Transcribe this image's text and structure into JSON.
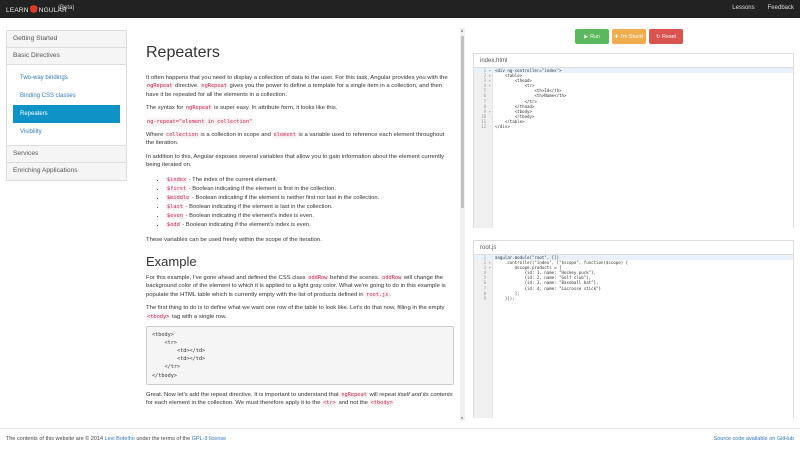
{
  "navbar": {
    "brand_left": "LEARN",
    "brand_right": "NGULAR",
    "beta": "(Beta)",
    "links": [
      "Lessons",
      "Feedback"
    ]
  },
  "sidebar": {
    "getting_started": "Getting Started",
    "basic_directives": "Basic Directives",
    "sub_items": [
      "Two-way bindings",
      "Binding CSS classes",
      "Repeaters",
      "Visibility"
    ],
    "active_item": "Repeaters",
    "services": "Services",
    "enriching": "Enriching Applications"
  },
  "content": {
    "title": "Repeaters",
    "p1a": "It often happens that you need to display a collection of data to the user. For this task, Angular provides you with the",
    "p1_code": "ngRepeat",
    "p1b": "directive.",
    "p1_code2": "ngRepeat",
    "p1c": "gives you the power to define a template for a single item in a collection, and then have it be repeated for all the elements in a collection.",
    "p2a": "The syntax for",
    "p2_code": "ngRepeat",
    "p2b": "is super easy. In attribute form, it looks like this.",
    "syntax_code": "ng-repeat=\"element in collection\"",
    "p3a": "Where",
    "p3_code1": "collection",
    "p3b": "is a collection in scope and",
    "p3_code2": "element",
    "p3c": "is a variable used to reference each element throughout the iteration.",
    "p4": "In addition to this, Angular exposes several variables that allow you to gain information about the element currently being iterated on.",
    "vars": [
      {
        "code": "$index",
        "text": " - The index of the current element."
      },
      {
        "code": "$first",
        "text": " - Boolean indicating if the element is first in the collection."
      },
      {
        "code": "$middle",
        "text": " - Boolean indicating if the element is neither first nor last in the collection."
      },
      {
        "code": "$last",
        "text": " - Boolean indicating if the element is last in the collection."
      },
      {
        "code": "$even",
        "text": " - Boolean indicating if the element's index is even."
      },
      {
        "code": "$odd",
        "text": " - Boolean indicating if the element's index is even."
      }
    ],
    "p5": "These variables can be used freely within the scope of the iteration.",
    "example_title": "Example",
    "p6a": "For this example, I've gone ahead and defined the CSS class",
    "p6_code1": "oddRow",
    "p6b": "behind the scenes.",
    "p6_code2": "oddRow",
    "p6c": "will change the background color of the element to which it is applied to a light gray color. What we're going to do in this example is populate the HTML table which is currently empty with the list of products defined in",
    "p6_code3": "root.js",
    "p6d": ".",
    "p7a": "The first thing to do is to define what we want one row of the table to look like. Let's do that now, filling in the empty",
    "p7_code": "<tbody>",
    "p7b": "tag with a single row.",
    "code_block": "<tbody>\n    <tr>\n        <td></td>\n        <td></td>\n    </tr>\n</tbody>",
    "p8a": "Great. Now let's add the repeat directive. It is important to understand that",
    "p8_code": "ngRepeat",
    "p8b": "will repeat",
    "p8_em": "itself and its contents",
    "p8c": "for each element in the collection. We must therefore apply it to the",
    "p8_code2": "<tr>",
    "p8d": "and not the",
    "p8_code3": "<tbody>"
  },
  "buttons": {
    "run": "Run",
    "stuck": "I'm Stuck!",
    "reset": "Reset"
  },
  "editor_html": {
    "tab": "index.html",
    "lines": [
      "<div ng-controller=\"index\">",
      "    <table>",
      "        <thead>",
      "            <tr>",
      "                <th>Id</th>",
      "                <th>Name</th>",
      "            </tr>",
      "        </thead>",
      "        <tbody>",
      "        </tbody>",
      "    </table>",
      "</div>"
    ]
  },
  "editor_js": {
    "tab": "root.js",
    "lines": [
      "angular.module(\"root\", [])",
      "    .controller(\"index\", [\"$scope\", function($scope) {",
      "        $scope.products = [",
      "            {id: 1, name: \"Hockey puck\"},",
      "            {id: 2, name: \"Golf club\"},",
      "            {id: 3, name: \"Baseball bat\"},",
      "            {id: 4, name: \"Lacrosse stick\"}",
      "        ];",
      "    }]);"
    ]
  },
  "footer": {
    "left_a": "The contents of this website are © 2014",
    "left_link": "Levi Botelho",
    "left_b": "under the terms of the",
    "left_license": "GPL-3 license",
    "right": "Source code available on GitHub"
  }
}
